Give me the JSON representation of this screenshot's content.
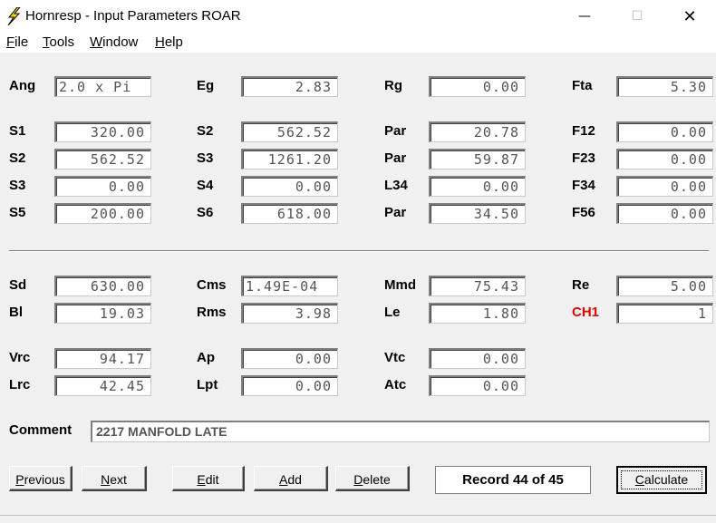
{
  "window": {
    "title": "Hornresp - Input Parameters   ROAR",
    "minimize": "—",
    "maximize": "☐",
    "close": "✕"
  },
  "menu": [
    {
      "first": "F",
      "rest": "ile"
    },
    {
      "first": "T",
      "rest": "ools"
    },
    {
      "first": "W",
      "rest": "indow"
    },
    {
      "first": "H",
      "rest": "elp"
    }
  ],
  "row_ang": {
    "ang": {
      "label": "Ang",
      "value": "2.0 x Pi"
    },
    "eg": {
      "label": "Eg",
      "value": "2.83"
    },
    "rg": {
      "label": "Rg",
      "value": "0.00"
    },
    "fta": {
      "label": "Fta",
      "value": "5.30"
    }
  },
  "horn": [
    [
      {
        "label": "S1",
        "value": "320.00"
      },
      {
        "label": "S2",
        "value": "562.52"
      },
      {
        "label": "Par",
        "value": "20.78"
      },
      {
        "label": "F12",
        "value": "0.00"
      }
    ],
    [
      {
        "label": "S2",
        "value": "562.52"
      },
      {
        "label": "S3",
        "value": "1261.20"
      },
      {
        "label": "Par",
        "value": "59.87"
      },
      {
        "label": "F23",
        "value": "0.00"
      }
    ],
    [
      {
        "label": "S3",
        "value": "0.00"
      },
      {
        "label": "S4",
        "value": "0.00"
      },
      {
        "label": "L34",
        "value": "0.00"
      },
      {
        "label": "F34",
        "value": "0.00"
      }
    ],
    [
      {
        "label": "S5",
        "value": "200.00"
      },
      {
        "label": "S6",
        "value": "618.00"
      },
      {
        "label": "Par",
        "value": "34.50"
      },
      {
        "label": "F56",
        "value": "0.00"
      }
    ]
  ],
  "driver": [
    [
      {
        "label": "Sd",
        "value": "630.00"
      },
      {
        "label": "Cms",
        "value": "1.49E-04"
      },
      {
        "label": "Mmd",
        "value": "75.43"
      },
      {
        "label": "Re",
        "value": "5.00"
      }
    ],
    [
      {
        "label": "Bl",
        "value": "19.03"
      },
      {
        "label": "Rms",
        "value": "3.98"
      },
      {
        "label": "Le",
        "value": "1.80"
      },
      {
        "label": "CH1",
        "value": "1"
      }
    ]
  ],
  "chambers": [
    [
      {
        "label": "Vrc",
        "value": "94.17"
      },
      {
        "label": "Ap",
        "value": "0.00"
      },
      {
        "label": "Vtc",
        "value": "0.00"
      }
    ],
    [
      {
        "label": "Lrc",
        "value": "42.45"
      },
      {
        "label": "Lpt",
        "value": "0.00"
      },
      {
        "label": "Atc",
        "value": "0.00"
      }
    ]
  ],
  "comment": {
    "label": "Comment",
    "value": "2217 MANFOLD LATE"
  },
  "buttons": {
    "previous": {
      "first": "P",
      "rest": "revious"
    },
    "next": {
      "first": "N",
      "rest": "ext"
    },
    "edit": {
      "first": "E",
      "rest": "dit"
    },
    "add": {
      "first": "A",
      "rest": "dd"
    },
    "delete": {
      "first": "D",
      "rest": "elete"
    },
    "calculate": {
      "first": "C",
      "rest": "alculate"
    }
  },
  "record": "Record 44 of 45",
  "colors": {
    "ch1_label": "#e00000",
    "icon": "#f5d800"
  }
}
